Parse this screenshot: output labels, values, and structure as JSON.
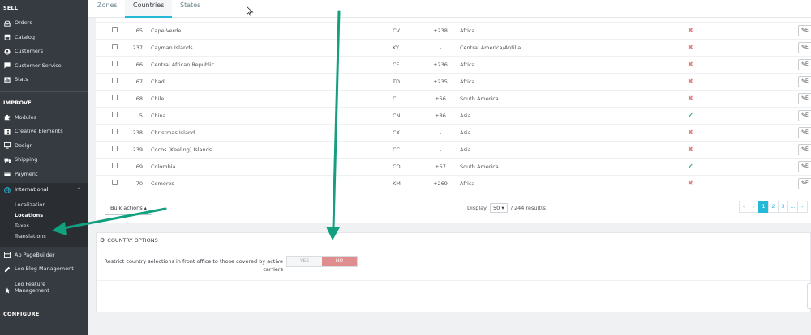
{
  "sidebar": {
    "section_sell": "SELL",
    "sell_items": [
      {
        "label": "Orders",
        "icon": "inbox-icon"
      },
      {
        "label": "Catalog",
        "icon": "store-icon"
      },
      {
        "label": "Customers",
        "icon": "user-icon"
      },
      {
        "label": "Customer Service",
        "icon": "chat-icon"
      },
      {
        "label": "Stats",
        "icon": "chart-icon"
      }
    ],
    "section_improve": "IMPROVE",
    "improve_items": [
      {
        "label": "Modules",
        "icon": "puzzle-icon"
      },
      {
        "label": "Creative Elements",
        "icon": "elements-icon"
      },
      {
        "label": "Design",
        "icon": "monitor-icon"
      },
      {
        "label": "Shipping",
        "icon": "truck-icon"
      },
      {
        "label": "Payment",
        "icon": "card-icon"
      }
    ],
    "international": {
      "label": "International",
      "icon": "globe-icon"
    },
    "international_sub": [
      "Localization",
      "Locations",
      "Taxes",
      "Translations"
    ],
    "extra_items": [
      {
        "label": "Ap PageBuilder",
        "icon": "layout-icon"
      },
      {
        "label": "Leo Blog Management",
        "icon": "pencil-icon"
      },
      {
        "label": "Leo Feature Management",
        "icon": "star-icon"
      }
    ],
    "section_configure": "CONFIGURE"
  },
  "tabs": [
    "Zones",
    "Countries",
    "States"
  ],
  "table": {
    "rows": [
      {
        "id": "65",
        "name": "Cape Verde",
        "iso": "CV",
        "call": "+238",
        "zone": "Africa",
        "enabled": false
      },
      {
        "id": "237",
        "name": "Cayman Islands",
        "iso": "KY",
        "call": "-",
        "zone": "Central America/Antilla",
        "enabled": false
      },
      {
        "id": "66",
        "name": "Central African Republic",
        "iso": "CF",
        "call": "+236",
        "zone": "Africa",
        "enabled": false
      },
      {
        "id": "67",
        "name": "Chad",
        "iso": "TD",
        "call": "+235",
        "zone": "Africa",
        "enabled": false
      },
      {
        "id": "68",
        "name": "Chile",
        "iso": "CL",
        "call": "+56",
        "zone": "South America",
        "enabled": false
      },
      {
        "id": "5",
        "name": "China",
        "iso": "CN",
        "call": "+86",
        "zone": "Asia",
        "enabled": true
      },
      {
        "id": "238",
        "name": "Christmas Island",
        "iso": "CX",
        "call": "-",
        "zone": "Asia",
        "enabled": false
      },
      {
        "id": "239",
        "name": "Cocos (Keeling) Islands",
        "iso": "CC",
        "call": "-",
        "zone": "Asia",
        "enabled": false
      },
      {
        "id": "69",
        "name": "Colombia",
        "iso": "CO",
        "call": "+57",
        "zone": "South America",
        "enabled": true
      },
      {
        "id": "70",
        "name": "Comoros",
        "iso": "KM",
        "call": "+269",
        "zone": "Africa",
        "enabled": false
      }
    ],
    "edit_label": "E",
    "bulk_label": "Bulk actions ▴",
    "display_label": "Display",
    "display_value": "50",
    "display_total": "/ 244 result(s)",
    "pages": [
      "«",
      "‹",
      "1",
      "2",
      "3",
      "...",
      "›"
    ],
    "current_page": "1"
  },
  "options": {
    "title": "COUNTRY OPTIONS",
    "label": "Restrict country selections in front office to those covered by active carriers",
    "yes": "YES",
    "no": "NO",
    "value": "NO"
  },
  "colors": {
    "accent": "#25b9d7",
    "sidebar": "#363a41",
    "annotation_arrow": "#12a07e",
    "disabled": "#e08282",
    "enabled": "#3cb371"
  }
}
